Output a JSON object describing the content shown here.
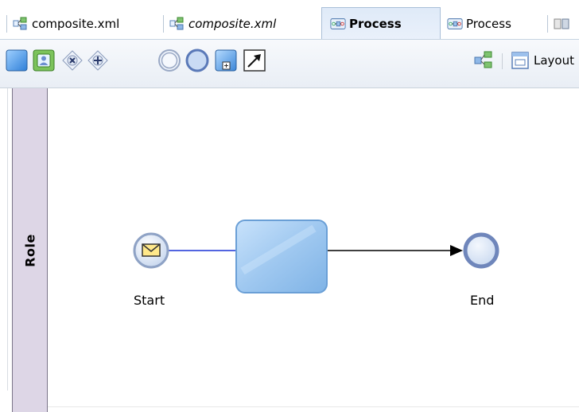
{
  "tabs": [
    {
      "label": "composite.xml",
      "icon": "composite-icon",
      "italic": false,
      "active": false
    },
    {
      "label": "composite.xml",
      "icon": "composite-icon",
      "italic": true,
      "active": false
    },
    {
      "label": "Process",
      "icon": "process-icon",
      "italic": false,
      "active": true
    },
    {
      "label": "Process",
      "icon": "process-icon",
      "italic": false,
      "active": false
    }
  ],
  "toolbar": {
    "tools": [
      {
        "name": "activity-tool-icon"
      },
      {
        "name": "user-task-tool-icon"
      },
      {
        "name": "exclusive-gateway-tool-icon"
      },
      {
        "name": "parallel-gateway-tool-icon"
      },
      {
        "name": "intermediate-event-tool-icon"
      },
      {
        "name": "end-event-tool-icon"
      },
      {
        "name": "subprocess-tool-icon"
      },
      {
        "name": "sequence-flow-tool-icon"
      }
    ],
    "layout_label": "Layout"
  },
  "lane": {
    "label": "Role"
  },
  "diagram": {
    "start_label": "Start",
    "end_label": "End"
  },
  "colors": {
    "flow_line": "#1a32d6",
    "arrow_line": "#000000",
    "lane_fill": "#ddd6e6",
    "event_fill": "#dbe6f7",
    "task_fill": "#a9cdf0"
  }
}
